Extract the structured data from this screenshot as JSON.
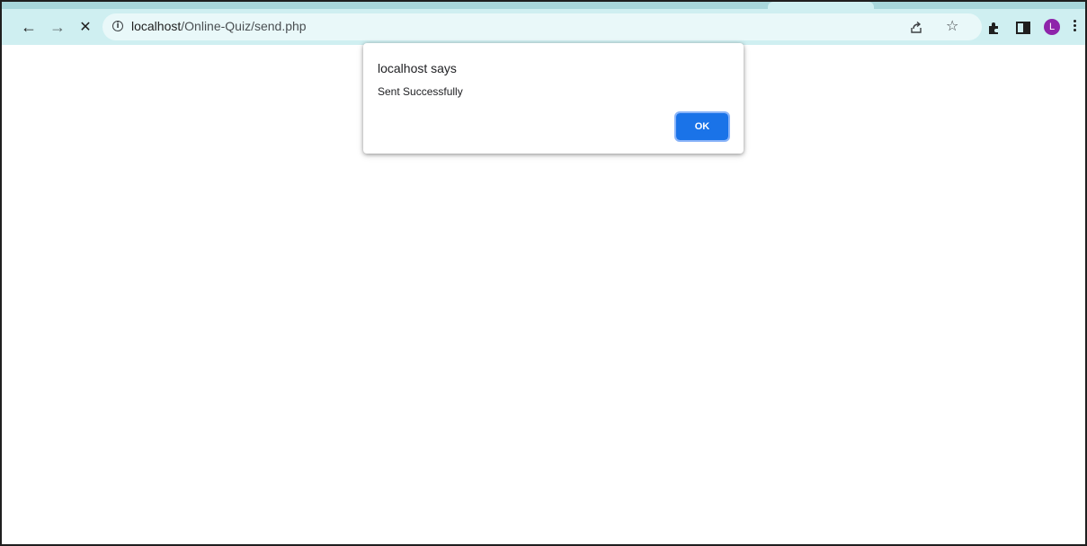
{
  "browser": {
    "nav": {
      "back_glyph": "←",
      "forward_glyph": "→",
      "stop_glyph": "✕"
    },
    "omnibox": {
      "host": "localhost",
      "path": "/Online-Quiz/send.php"
    },
    "profile_initial": "L",
    "icons": [
      "back-icon",
      "forward-icon",
      "stop-icon",
      "info-icon",
      "share-icon",
      "star-icon",
      "extensions-icon",
      "side-panel-icon",
      "avatar",
      "menu-icon"
    ],
    "colors": {
      "toolbar": "#cfeff1",
      "tabstrip": "#a8d7db",
      "avatar": "#8e24aa",
      "ok_button": "#1a73e8"
    }
  },
  "dialog": {
    "title": "localhost says",
    "message": "Sent Successfully",
    "ok_label": "OK"
  }
}
